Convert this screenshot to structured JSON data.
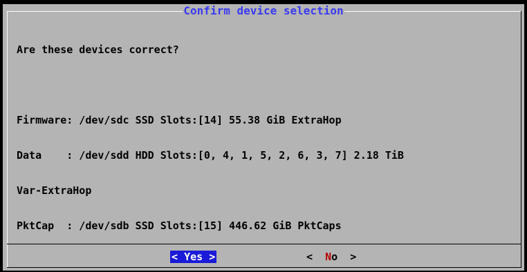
{
  "dialog": {
    "title": "Confirm device selection",
    "question": "Are these devices correct?",
    "lines": [
      "Firmware: /dev/sdc SSD Slots:[14] 55.38 GiB ExtraHop",
      "Data    : /dev/sdd HDD Slots:[0, 4, 1, 5, 2, 6, 3, 7] 2.18 TiB",
      "Var-ExtraHop",
      "PktCap  : /dev/sdb SSD Slots:[15] 446.62 GiB PktCaps"
    ]
  },
  "buttons": {
    "yes": {
      "open": "<",
      "label": "Yes",
      "close": ">"
    },
    "no": {
      "open": "<",
      "hotkey": "N",
      "rest": "o",
      "close": ">"
    }
  },
  "colors": {
    "background": "#000000",
    "dialog": "#b4b4b4",
    "title": "#3a3af0",
    "selected_button": "#1a1ad8",
    "hotkey": "#b40000"
  }
}
